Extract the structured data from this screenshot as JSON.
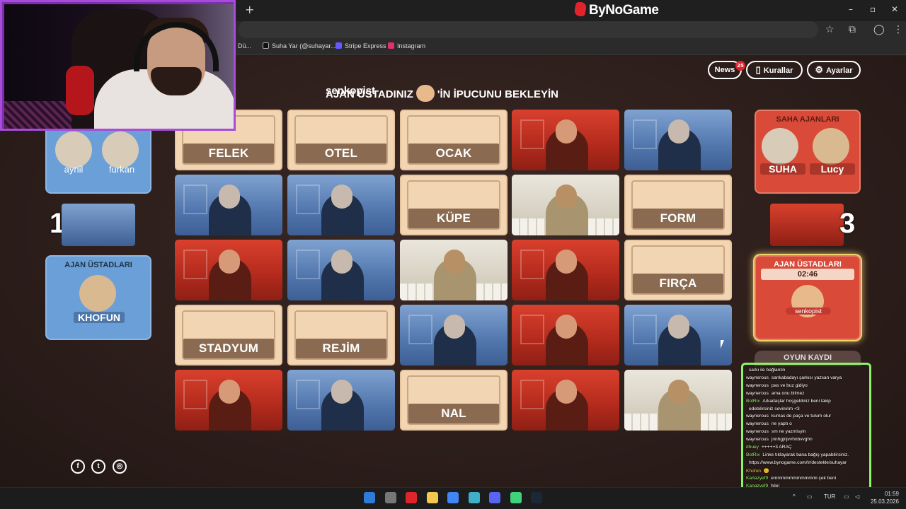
{
  "browser": {
    "brand": "ByNoGame",
    "new_tab": "+",
    "minimize": "–",
    "maximize": "▫",
    "close": "✕",
    "bookmarks": [
      {
        "label": "Dü...",
        "color": "#888"
      },
      {
        "label": "Suha Yar (@suhayar...",
        "color": "#111"
      },
      {
        "label": "Stripe Express",
        "color": "#635bff"
      },
      {
        "label": "Instagram",
        "color": "#e1306c"
      }
    ]
  },
  "header": {
    "news_label": "News",
    "news_badge": "25",
    "rules_label": "Kurallar",
    "settings_label": "Ayarlar"
  },
  "status": {
    "before": "AJAN ÜSTADINIZ",
    "after": "'İN İPUCUNU BEKLEYİN",
    "avatar_label": "senkopist"
  },
  "board": [
    {
      "word": "FELEK",
      "type": "word"
    },
    {
      "word": "OTEL",
      "type": "word"
    },
    {
      "word": "OCAK",
      "type": "word"
    },
    {
      "word": "",
      "type": "red"
    },
    {
      "word": "",
      "type": "blue"
    },
    {
      "word": "",
      "type": "blue"
    },
    {
      "word": "",
      "type": "blue"
    },
    {
      "word": "KÜPE",
      "type": "word"
    },
    {
      "word": "",
      "type": "neutral"
    },
    {
      "word": "FORM",
      "type": "word"
    },
    {
      "word": "",
      "type": "red"
    },
    {
      "word": "",
      "type": "blue"
    },
    {
      "word": "",
      "type": "neutral"
    },
    {
      "word": "",
      "type": "red"
    },
    {
      "word": "FIRÇA",
      "type": "word"
    },
    {
      "word": "STADYUM",
      "type": "word"
    },
    {
      "word": "REJİM",
      "type": "word"
    },
    {
      "word": "",
      "type": "blue"
    },
    {
      "word": "",
      "type": "red"
    },
    {
      "word": "",
      "type": "blue"
    },
    {
      "word": "",
      "type": "red"
    },
    {
      "word": "",
      "type": "blue"
    },
    {
      "word": "NAL",
      "type": "word"
    },
    {
      "word": "",
      "type": "red"
    },
    {
      "word": "",
      "type": "neutral"
    }
  ],
  "blue_team": {
    "agents": [
      "aynil",
      "furkan"
    ],
    "remaining": "1",
    "spymaster_title": "AJAN ÜSTADLARI",
    "spymaster": "KHOFUN"
  },
  "red_team": {
    "agents_title": "SAHA AJANLARI",
    "agents": [
      "SUHA",
      "Lucy"
    ],
    "remaining": "3",
    "spymaster_title": "AJAN ÜSTADLARI",
    "timer": "02:46",
    "spymaster": "senkopist"
  },
  "game_log": {
    "label": "OYUN KAYDI"
  },
  "social": [
    {
      "name": "facebook",
      "glyph": "f"
    },
    {
      "name": "twitter",
      "glyph": "t"
    },
    {
      "name": "instagram",
      "glyph": "◎"
    }
  ],
  "chat": [
    {
      "user": "",
      "text": "sarkı ile bağlantılı",
      "color": "#ffffff"
    },
    {
      "user": "waynerous",
      "text": "sankabadayı şarkısı yazsan varya",
      "color": "#ffffff"
    },
    {
      "user": "waynerous",
      "text": "pas ve buz gidiyo",
      "color": "#ffffff"
    },
    {
      "user": "waynerous",
      "text": "ama onu bilmez",
      "color": "#ffffff"
    },
    {
      "user": "BotRix",
      "text": "Arkadaşlar hoşgeldiniz beni takip",
      "color": "#8ef06c"
    },
    {
      "user": "",
      "text": "edebilirsiniz sevinirim <3",
      "color": "#ffffff"
    },
    {
      "user": "waynerous",
      "text": "kumas de paça ve tulum olur",
      "color": "#ffffff"
    },
    {
      "user": "waynerous",
      "text": "ne yaptı o",
      "color": "#ffffff"
    },
    {
      "user": "waynerous",
      "text": "sm ne yazmisyin",
      "color": "#ffffff"
    },
    {
      "user": "waynerous",
      "text": "jnnhgjnjvvhnbvvghn",
      "color": "#ffffff"
    },
    {
      "user": "dhuey",
      "text": "+++++3 ARAÇ",
      "color": "#8ef06c"
    },
    {
      "user": "BotRix",
      "text": "Linke tıklayarak bana bağış yapabilirsiniz.",
      "color": "#8ef06c"
    },
    {
      "user": "",
      "text": "https://www.bynogame.com/tr/destekle/suhayar",
      "color": "#ffffff"
    },
    {
      "user": "Khofun",
      "text": "😊",
      "color": "#f2c94c"
    },
    {
      "user": "Karlazyef9",
      "text": "emmmmmmmmmmmi çek beni",
      "color": "#8ef06c"
    },
    {
      "user": "Kanazyef9",
      "text": "hile!",
      "color": "#8ef06c"
    }
  ],
  "taskbar": {
    "apps": [
      "#2f7bd9",
      "#777777",
      "#e0242b",
      "#f2c94c",
      "#4285f4",
      "#3fb0c8",
      "#5865f2",
      "#3fd27a",
      "#1b2838"
    ],
    "lang": "TUR",
    "time": "01:59",
    "date": "25.03.2026"
  }
}
